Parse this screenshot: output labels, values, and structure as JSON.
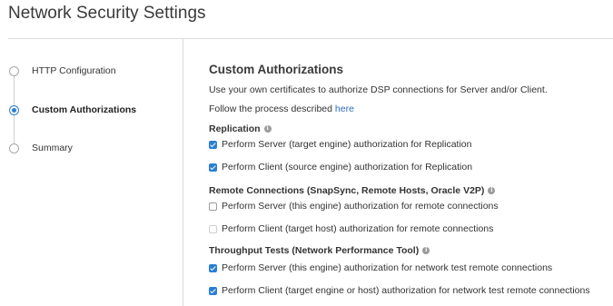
{
  "page": {
    "title": "Network Security Settings"
  },
  "steps": [
    {
      "label": "HTTP Configuration",
      "active": false
    },
    {
      "label": "Custom Authorizations",
      "active": true
    },
    {
      "label": "Summary",
      "active": false
    }
  ],
  "main": {
    "section_title": "Custom Authorizations",
    "description": "Use your own certificates to authorize DSP connections for Server and/or Client.",
    "follow_text": "Follow the process described ",
    "follow_link": "here",
    "groups": [
      {
        "title": "Replication",
        "items": [
          {
            "label": "Perform Server (target engine) authorization for Replication",
            "checked": true
          },
          {
            "label": "Perform Client (source engine) authorization for Replication",
            "checked": true
          }
        ]
      },
      {
        "title": "Remote Connections (SnapSync, Remote Hosts, Oracle V2P)",
        "items": [
          {
            "label": "Perform Server (this engine) authorization for remote connections",
            "checked": false
          },
          {
            "label": "Perform Client (target host) authorization for remote connections",
            "checked": false,
            "disabled": true
          }
        ]
      },
      {
        "title": "Throughput Tests (Network Performance Tool)",
        "items": [
          {
            "label": "Perform Server (this engine) authorization for network test remote connections",
            "checked": true
          },
          {
            "label": "Perform Client (target engine or host) authorization for network test remote connections",
            "checked": true
          }
        ]
      }
    ]
  },
  "colors": {
    "accent": "#2a7fd4",
    "link": "#2a6ebd"
  },
  "icons": {
    "info": "info-icon",
    "step_radio": "radio-icon"
  }
}
